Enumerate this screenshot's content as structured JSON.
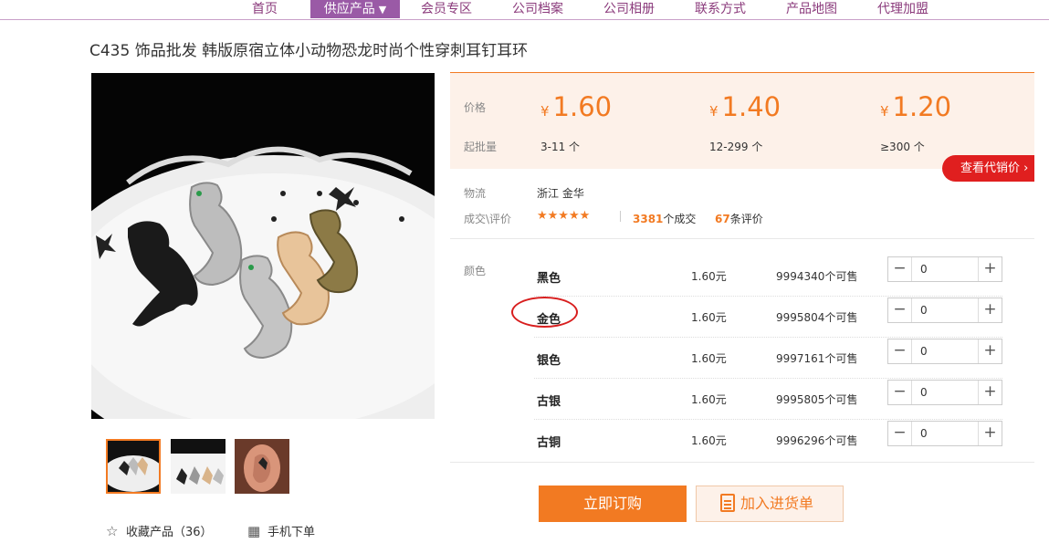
{
  "nav": {
    "items": [
      "首页",
      "供应产品",
      "会员专区",
      "公司档案",
      "公司相册",
      "联系方式",
      "产品地图",
      "代理加盟"
    ],
    "active_caret": "▼"
  },
  "product": {
    "title": "C435 饰品批发 韩版原宿立体小动物恐龙时尚个性穿刺耳钉耳环"
  },
  "price_panel": {
    "price_label": "价格",
    "moq_label": "起批量",
    "currency": "¥",
    "tiers": [
      {
        "price": "1.60",
        "range": "3-11 个"
      },
      {
        "price": "1.40",
        "range": "12-299 个"
      },
      {
        "price": "1.20",
        "range": "≥300 个"
      }
    ],
    "agent_button": "查看代销价 ›"
  },
  "info": {
    "logistics_label": "物流",
    "logistics_value": "浙江 金华",
    "deals_label": "成交\\评价",
    "stars": "★★★★★",
    "deal_count": "3381",
    "deal_suffix": "个成交",
    "review_count": "67",
    "review_suffix": "条评价"
  },
  "sku": {
    "color_label": "颜色",
    "rows": [
      {
        "name": "黑色",
        "price": "1.60元",
        "stock": "9994340个可售",
        "qty": "0"
      },
      {
        "name": "金色",
        "price": "1.60元",
        "stock": "9995804个可售",
        "qty": "0"
      },
      {
        "name": "银色",
        "price": "1.60元",
        "stock": "9997161个可售",
        "qty": "0"
      },
      {
        "name": "古银",
        "price": "1.60元",
        "stock": "9995805个可售",
        "qty": "0"
      },
      {
        "name": "古铜",
        "price": "1.60元",
        "stock": "9996296个可售",
        "qty": "0"
      }
    ],
    "minus": "−",
    "plus": "+"
  },
  "actions": {
    "buy": "立即订购",
    "cart": "加入进货单",
    "collect": "收藏产品（36）",
    "mobile": "手机下单"
  },
  "icons": {
    "collect": "star-outline-icon",
    "mobile": "qr-code-icon",
    "cart": "clipboard-icon"
  },
  "colors": {
    "accent": "#f27a22",
    "nav_active": "#9a5aa6",
    "nav_text": "#8b3b7c",
    "agent_red": "#e01f1f",
    "panel_bg": "#fdf1e9"
  }
}
